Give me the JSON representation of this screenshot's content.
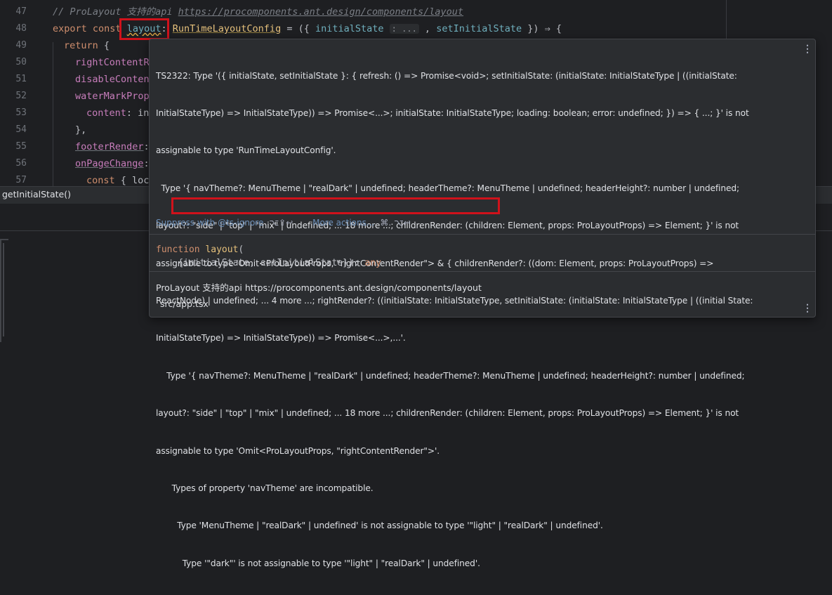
{
  "editor": {
    "line_numbers": [
      "47",
      "48",
      "49",
      "50",
      "51",
      "52",
      "53",
      "54",
      "55",
      "56",
      "57"
    ],
    "line47": {
      "comment": "// ProLayout 支持的api ",
      "link": "https://procomponents.ant.design/components/layout"
    },
    "line48": {
      "kw_export": "export",
      "kw_const": "const",
      "name": "layout",
      "colon": ":",
      "type": "RunTimeLayoutConfig",
      "eq": " = ({ ",
      "param1": "initialState",
      "hint": ": ...",
      "comma": " , ",
      "param2": "setInitialState",
      "arrow": " }) ⇒ {"
    },
    "line49": {
      "kw": "return",
      "rest": " {"
    },
    "line50": {
      "prop": "rightContentR"
    },
    "line51": {
      "prop": "disableConten"
    },
    "line52": {
      "prop": "waterMarkProp"
    },
    "line53": {
      "prop": "content",
      "rest": ": in"
    },
    "line54": {
      "text": "},"
    },
    "line55": {
      "prop": "footerRender",
      "rest": ":"
    },
    "line56": {
      "prop": "onPageChange",
      "rest": ":"
    },
    "line57": {
      "kw": "const",
      "rest": " { loc"
    }
  },
  "structure": {
    "text": "getInitialState()"
  },
  "popup": {
    "error_lines": [
      "TS2322: Type '({ initialState, setInitialState }: { refresh: () => Promise<void>; setInitialState: (initialState: InitialStateType | ((initialState:",
      "InitialStateType) => InitialStateType)) => Promise<...>; initialState: InitialStateType; loading: boolean; error: undefined; }) => { ...; }' is not",
      "assignable to type 'RunTimeLayoutConfig'.",
      "  Type '{ navTheme?: MenuTheme | \"realDark\" | undefined; headerTheme?: MenuTheme | undefined; headerHeight?: number | undefined;",
      "layout?: \"side\" | \"top\" | \"mix\" | undefined; ... 18 more ...; childrenRender: (children: Element, props: ProLayoutProps) => Element; }' is not",
      "assignable to type 'Omit<ProLayoutProps, \"rightContentRender\"> & { childrenRender?: ((dom: Element, props: ProLayoutProps) =>",
      "ReactNode) | undefined; ... 4 more ...; rightRender?: ((initialState: InitialStateType, setInitialState: (initialState: InitialStateType | ((initial State:",
      "InitialStateType) => InitialStateType)) => Promise<...>,...'.",
      "    Type '{ navTheme?: MenuTheme | \"realDark\" | undefined; headerTheme?: MenuTheme | undefined; headerHeight?: number | undefined;",
      "layout?: \"side\" | \"top\" | \"mix\" | undefined; ... 18 more ...; childrenRender: (children: Element, props: ProLayoutProps) => Element; }' is not",
      "assignable to type 'Omit<ProLayoutProps, \"rightContentRender\">'.",
      "      Types of property 'navTheme' are incompatible.",
      "        Type 'MenuTheme | \"realDark\" | undefined' is not assignable to type '\"light\" | \"realDark\" | undefined'.",
      "          Type '\"dark\"' is not assignable to type '\"light\" | \"realDark\" | undefined'."
    ],
    "suppress": {
      "label": "Suppress with @ts-ignore",
      "shortcut": "⌥⇧↩"
    },
    "more_actions": {
      "label": "More actions...",
      "shortcut": "⌘. ⌥↩"
    },
    "signature": {
      "kw": "function",
      "name": "layout",
      "open": "(",
      "params": "{initialState, setInitialState}",
      "close": "): ",
      "ret": "any"
    },
    "doc": "ProLayout 支持的api https://procomponents.ant.design/components/layout",
    "file": "src/app.tsx",
    "menu_icon": "⋮"
  }
}
